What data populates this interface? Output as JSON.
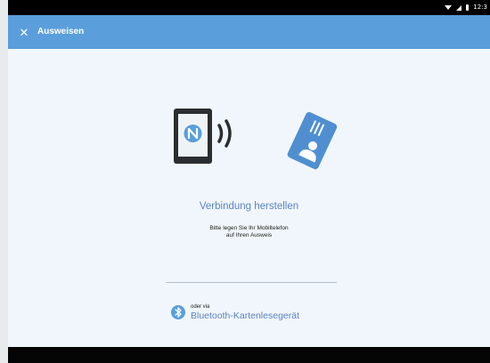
{
  "status_bar": {
    "time": "12:3",
    "icons": [
      "wifi-icon",
      "signal-icon",
      "battery-icon"
    ]
  },
  "app_bar": {
    "close_icon": "close-icon",
    "close_glyph": "✕",
    "title": "Ausweisen"
  },
  "illustration": {
    "phone": "nfc-phone-icon",
    "waves": "contactless-waves-icon",
    "card": "id-card-icon"
  },
  "connect": {
    "heading": "Verbindung herstellen",
    "instruction_line1": "Bitte legen Sie Ihr Mobiltelefon",
    "instruction_line2": "auf Ihren Ausweis"
  },
  "bluetooth": {
    "icon": "bluetooth-icon",
    "or_via": "oder via",
    "label": "Bluetooth-Kartenlesegerät"
  },
  "colors": {
    "app_bar": "#5a9edb",
    "accent_text": "#5b83c6",
    "background": "#f0f6fb",
    "phone_body": "#2b2e30",
    "card": "#4f8fd1"
  }
}
